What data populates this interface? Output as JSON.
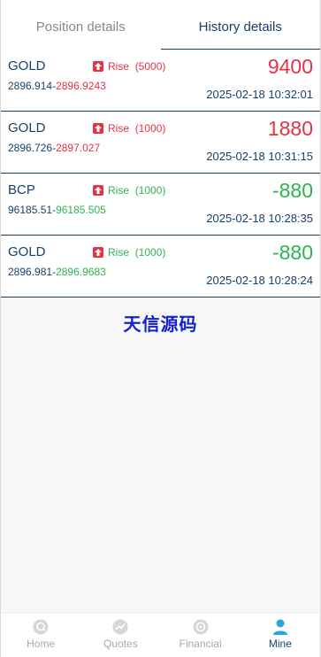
{
  "tabs": [
    {
      "label": "Position details"
    },
    {
      "label": "History details"
    }
  ],
  "active_tab": 1,
  "records": [
    {
      "symbol": "GOLD",
      "direction": "Rise",
      "amount": "(5000)",
      "price_open": "2896.914",
      "price_close": "2896.9243",
      "pnl": "9400",
      "time": "2025-02-18 10:32:01",
      "result": "win"
    },
    {
      "symbol": "GOLD",
      "direction": "Rise",
      "amount": "(1000)",
      "price_open": "2896.726",
      "price_close": "2897.027",
      "pnl": "1880",
      "time": "2025-02-18 10:31:15",
      "result": "win"
    },
    {
      "symbol": "BCP",
      "direction": "Rise",
      "amount": "(1000)",
      "price_open": "96185.51",
      "price_close": "96185.505",
      "pnl": "-880",
      "time": "2025-02-18 10:28:35",
      "result": "loss"
    },
    {
      "symbol": "GOLD",
      "direction": "Rise",
      "amount": "(1000)",
      "price_open": "2896.981",
      "price_close": "2896.9683",
      "pnl": "-880",
      "time": "2025-02-18 10:28:24",
      "result": "loss"
    }
  ],
  "watermark": "天信源码",
  "nav": [
    {
      "label": "Home",
      "icon": "home-icon"
    },
    {
      "label": "Quotes",
      "icon": "quotes-icon"
    },
    {
      "label": "Financial",
      "icon": "financial-icon"
    },
    {
      "label": "Mine",
      "icon": "user-icon"
    }
  ],
  "active_nav": 3,
  "colors": {
    "win": "#e53245",
    "loss": "#2fb34f",
    "primary": "#17406b",
    "watermark": "#1422cc"
  }
}
